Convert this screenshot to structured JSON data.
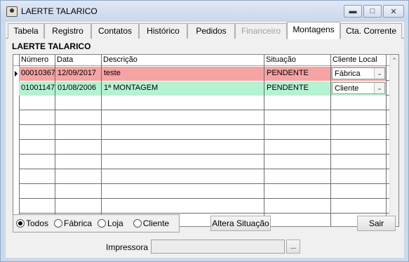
{
  "window": {
    "title": "LAERTE TALARICO"
  },
  "tabs": [
    {
      "label": "Tabela",
      "enabled": true
    },
    {
      "label": "Registro",
      "enabled": true
    },
    {
      "label": "Contatos",
      "enabled": true
    },
    {
      "label": "Histórico",
      "enabled": true
    },
    {
      "label": "Pedidos",
      "enabled": true
    },
    {
      "label": "Financeiro",
      "enabled": false
    },
    {
      "label": "Montagens",
      "enabled": true,
      "active": true
    },
    {
      "label": "Cta. Corrente",
      "enabled": true
    }
  ],
  "section_title": "LAERTE TALARICO",
  "grid": {
    "columns": [
      "Número",
      "Data",
      "Descrição",
      "Situação",
      "Cliente Local"
    ],
    "rows": [
      {
        "numero": "00010367",
        "data": "12/09/2017",
        "descricao": "teste",
        "situacao": "PENDENTE",
        "cliente_local": "Fábrica",
        "color": "#f5a3a3"
      },
      {
        "numero": "01001147",
        "data": "01/08/2006",
        "descricao": "1ª MONTAGEM",
        "situacao": "PENDENTE",
        "cliente_local": "Cliente",
        "color": "#b5f2d2"
      }
    ]
  },
  "filter": {
    "options": [
      "Todos",
      "Fábrica",
      "Loja",
      "Cliente"
    ],
    "selected": "Todos"
  },
  "buttons": {
    "altera_situacao": "Altera Situação",
    "sair": "Sair",
    "browse": "..."
  },
  "impressora": {
    "label": "Impressora",
    "value": ""
  },
  "icons": {
    "minimize": "minimize-icon",
    "maximize": "maximize-icon",
    "close": "close-icon"
  }
}
